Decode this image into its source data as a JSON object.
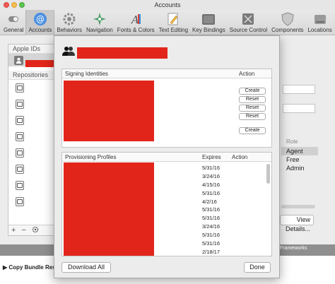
{
  "window": {
    "title": "Accounts"
  },
  "toolbar": {
    "items": [
      {
        "label": "General",
        "icon": "switch-icon"
      },
      {
        "label": "Accounts",
        "icon": "at-icon"
      },
      {
        "label": "Behaviors",
        "icon": "gears-icon"
      },
      {
        "label": "Navigation",
        "icon": "compass-icon"
      },
      {
        "label": "Fonts & Colors",
        "icon": "palette-icon"
      },
      {
        "label": "Text Editing",
        "icon": "pencil-icon"
      },
      {
        "label": "Key Bindings",
        "icon": "keyboard-icon"
      },
      {
        "label": "Source Control",
        "icon": "source-control-icon"
      },
      {
        "label": "Components",
        "icon": "shield-icon"
      },
      {
        "label": "Locations",
        "icon": "drive-icon"
      }
    ]
  },
  "left_pane": {
    "apple_ids_header": "Apple IDs",
    "repositories_header": "Repositories",
    "footer": {
      "add": "+",
      "remove": "−"
    }
  },
  "right_pane": {
    "role_header": "Role",
    "roles": [
      "Agent",
      "Free",
      "Admin"
    ],
    "view_details": "View Details..."
  },
  "background": {
    "frameworks": "Frameworks",
    "copy_bundle": "Copy Bundle Reso"
  },
  "sheet": {
    "signing": {
      "header": "Signing Identities",
      "action_header": "Action",
      "buttons": [
        "Create",
        "Reset",
        "Reset",
        "Reset",
        "Create"
      ]
    },
    "profiles": {
      "header": "Provisioning Profiles",
      "expires_header": "Expires",
      "action_header": "Action",
      "dates": [
        "5/31/16",
        "3/24/16",
        "4/15/16",
        "5/31/16",
        "4/2/16",
        "5/31/16",
        "5/31/16",
        "3/24/16",
        "5/31/16",
        "5/31/16",
        "2/18/17"
      ]
    },
    "download_all": "Download All",
    "done": "Done"
  }
}
